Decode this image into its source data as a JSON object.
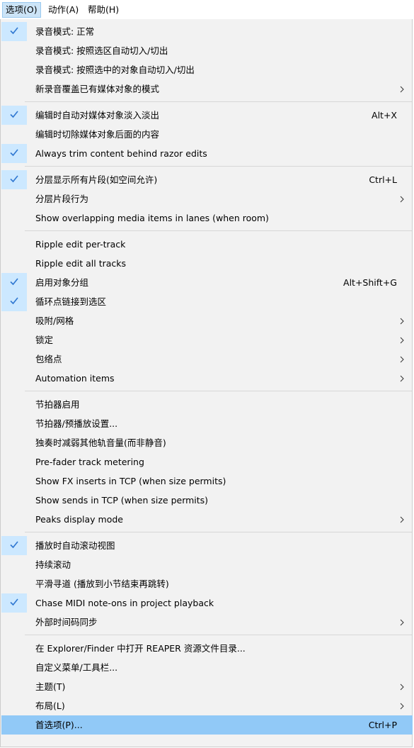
{
  "menubar": {
    "items": [
      {
        "label": "选项(O)"
      },
      {
        "label": "动作(A)"
      },
      {
        "label": "帮助(H)"
      }
    ]
  },
  "colors": {
    "menu_bg": "#f2f2f2",
    "check_bg": "#cce8ff",
    "highlight_bg": "#91c9f7",
    "check_color": "#2f77d1"
  },
  "menu": {
    "groups": [
      {
        "items": [
          {
            "label": "录音模式: 正常",
            "checked": true
          },
          {
            "label": "录音模式: 按照选区自动切入/切出"
          },
          {
            "label": "录音模式: 按照选中的对象自动切入/切出"
          },
          {
            "label": "新录音覆盖已有媒体对象的模式",
            "submenu": true
          }
        ]
      },
      {
        "items": [
          {
            "label": "编辑时自动对媒体对象淡入淡出",
            "checked": true,
            "shortcut": "Alt+X"
          },
          {
            "label": "编辑时切除媒体对象后面的内容"
          },
          {
            "label": "Always trim content behind razor edits",
            "checked": true
          }
        ]
      },
      {
        "items": [
          {
            "label": "分层显示所有片段(如空间允许)",
            "checked": true,
            "shortcut": "Ctrl+L"
          },
          {
            "label": "分层片段行为",
            "submenu": true
          },
          {
            "label": "Show overlapping media items in lanes (when room)"
          }
        ]
      },
      {
        "items": [
          {
            "label": "Ripple edit per-track"
          },
          {
            "label": "Ripple edit all tracks"
          },
          {
            "label": "启用对象分组",
            "checked": true,
            "shortcut": "Alt+Shift+G"
          },
          {
            "label": "循环点链接到选区",
            "checked": true
          },
          {
            "label": "吸附/网格",
            "submenu": true
          },
          {
            "label": "锁定",
            "submenu": true
          },
          {
            "label": "包络点",
            "submenu": true
          },
          {
            "label": "Automation items",
            "submenu": true
          }
        ]
      },
      {
        "items": [
          {
            "label": "节拍器启用"
          },
          {
            "label": "节拍器/预播放设置..."
          },
          {
            "label": "独奏时减弱其他轨音量(而非静音)"
          },
          {
            "label": "Pre-fader track metering"
          },
          {
            "label": "Show FX inserts in TCP (when size permits)"
          },
          {
            "label": "Show sends in TCP (when size permits)"
          },
          {
            "label": "Peaks display mode",
            "submenu": true
          }
        ]
      },
      {
        "items": [
          {
            "label": "播放时自动滚动视图",
            "checked": true
          },
          {
            "label": "持续滚动"
          },
          {
            "label": "平滑寻道 (播放到小节结束再跳转)"
          },
          {
            "label": "Chase MIDI note-ons in project playback",
            "checked": true
          },
          {
            "label": "外部时间码同步",
            "submenu": true
          }
        ]
      },
      {
        "items": [
          {
            "label": "在 Explorer/Finder 中打开 REAPER 资源文件目录..."
          },
          {
            "label": "自定义菜单/工具栏..."
          },
          {
            "label": "主题(T)",
            "submenu": true
          },
          {
            "label": "布局(L)",
            "submenu": true
          },
          {
            "label": "首选项(P)...",
            "shortcut": "Ctrl+P",
            "highlighted": true
          }
        ]
      }
    ]
  }
}
